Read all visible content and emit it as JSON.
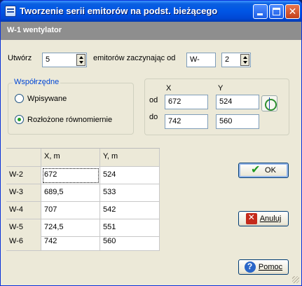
{
  "window": {
    "title": "Tworzenie serii emitorów na podst. bieżącego"
  },
  "header": {
    "label": "W-1 wentylator"
  },
  "create": {
    "label": "Utwórz",
    "count": "5",
    "middle_label": "emitorów zaczynając od",
    "prefix": "W-",
    "start": "2"
  },
  "coords_group": {
    "title": "Współrzędne",
    "options": [
      {
        "label": "Wpisywane",
        "selected": false
      },
      {
        "label": "Rozłożone równomiernie",
        "selected": true
      }
    ]
  },
  "range": {
    "x_label": "X",
    "y_label": "Y",
    "from_label": "od",
    "to_label": "do",
    "from_x": "672",
    "from_y": "524",
    "to_x": "742",
    "to_y": "560"
  },
  "table": {
    "columns": [
      "X, m",
      "Y, m"
    ],
    "rows": [
      {
        "name": "W-2",
        "x": "672",
        "y": "524"
      },
      {
        "name": "W-3",
        "x": "689,5",
        "y": "533"
      },
      {
        "name": "W-4",
        "x": "707",
        "y": "542"
      },
      {
        "name": "W-5",
        "x": "724,5",
        "y": "551"
      },
      {
        "name": "W-6",
        "x": "742",
        "y": "560"
      }
    ]
  },
  "buttons": {
    "ok": "OK",
    "cancel": "Anuluj",
    "help": "Pomoc"
  }
}
